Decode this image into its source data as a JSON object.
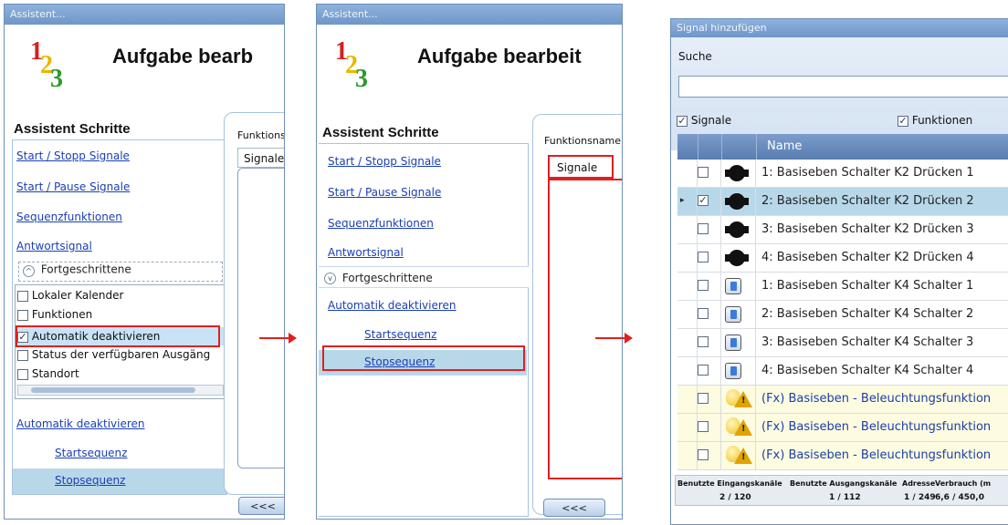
{
  "panel1": {
    "window_title": "Assistent...",
    "heading": "Aufgabe bearb",
    "logo_digits": [
      "1",
      "2",
      "3"
    ],
    "steps_title": "Assistent Schritte",
    "links": [
      "Start / Stopp Signale",
      "Start / Pause Signale",
      "Sequenzfunktionen",
      "Antwortsignal"
    ],
    "advanced_label": "Fortgeschrittene",
    "advanced_options": [
      {
        "label": "Lokaler Kalender",
        "checked": false
      },
      {
        "label": "Funktionen",
        "checked": false
      },
      {
        "label": "Automatik deaktivieren",
        "checked": true
      },
      {
        "label": "Status der verfügbaren Ausgäng",
        "checked": false
      },
      {
        "label": "Standort",
        "checked": false
      }
    ],
    "extra_links": [
      "Automatik deaktivieren",
      "Startsequenz",
      "Stopsequenz"
    ],
    "func_label": "Funktions",
    "tab_label": "Signale",
    "back_button": "<<<"
  },
  "panel2": {
    "window_title": "Assistent...",
    "heading": "Aufgabe bearbeit",
    "logo_digits": [
      "1",
      "2",
      "3"
    ],
    "steps_title": "Assistent Schritte",
    "links": [
      "Start / Stopp Signale",
      "Start / Pause Signale",
      "Sequenzfunktionen",
      "Antwortsignal"
    ],
    "advanced_label": "Fortgeschrittene",
    "extra_links": [
      "Automatik deaktivieren",
      "Startsequenz",
      "Stopsequenz"
    ],
    "func_label": "Funktionsname",
    "tab_label": "Signale",
    "back_button": "<<<"
  },
  "panel3": {
    "window_title": "Signal hinzufügen",
    "search_label": "Suche",
    "search_value": "",
    "filter_signals": "Signale",
    "filter_functions": "Funktionen",
    "column_name": "Name",
    "rows": [
      {
        "name": "1: Basiseben Schalter K2 Drücken 1",
        "icon": "k2-switch-icon",
        "checked": false,
        "selected": false
      },
      {
        "name": "2: Basiseben Schalter K2 Drücken 2",
        "icon": "k2-switch-icon",
        "checked": true,
        "selected": true
      },
      {
        "name": "3: Basiseben Schalter K2 Drücken 3",
        "icon": "k2-switch-icon",
        "checked": false,
        "selected": false
      },
      {
        "name": "4: Basiseben Schalter K2 Drücken 4",
        "icon": "k2-switch-icon",
        "checked": false,
        "selected": false
      },
      {
        "name": "1: Basiseben Schalter K4 Schalter 1",
        "icon": "k4-switch-icon",
        "checked": false,
        "selected": false
      },
      {
        "name": "2: Basiseben Schalter K4 Schalter 2",
        "icon": "k4-switch-icon",
        "checked": false,
        "selected": false
      },
      {
        "name": "3: Basiseben Schalter K4 Schalter 3",
        "icon": "k4-switch-icon",
        "checked": false,
        "selected": false
      },
      {
        "name": "4: Basiseben Schalter K4 Schalter 4",
        "icon": "k4-switch-icon",
        "checked": false,
        "selected": false
      },
      {
        "name": "(Fx) Basiseben - Beleuchtungsfunktion",
        "icon": "bulb-icon",
        "checked": false,
        "selected": false
      },
      {
        "name": "(Fx) Basiseben - Beleuchtungsfunktion",
        "icon": "bulb-icon",
        "checked": false,
        "selected": false
      },
      {
        "name": "(Fx) Basiseben - Beleuchtungsfunktion",
        "icon": "bulb-icon",
        "checked": false,
        "selected": false
      }
    ],
    "status_headers": [
      "Benutzte Eingangskanäle",
      "Benutzte Ausgangskanäle",
      "Adresse",
      "Verbrauch (m"
    ],
    "status_values": [
      "2 / 120",
      "1 / 112",
      "1 / 249",
      "6,6 / 450,0"
    ]
  },
  "colors": {
    "accent": "#6f96c8",
    "highlight": "#e02020",
    "selection": "#b8d8ea"
  }
}
